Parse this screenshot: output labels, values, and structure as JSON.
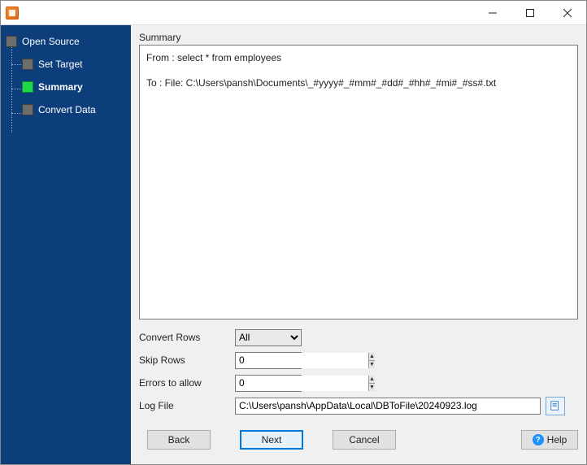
{
  "window": {
    "title": ""
  },
  "sidebar": {
    "items": [
      {
        "label": "Open Source"
      },
      {
        "label": "Set Target"
      },
      {
        "label": "Summary"
      },
      {
        "label": "Convert Data"
      }
    ]
  },
  "summary": {
    "section_label": "Summary",
    "from_line": "From : select * from employees",
    "to_line": "To : File: C:\\Users\\pansh\\Documents\\_#yyyy#_#mm#_#dd#_#hh#_#mi#_#ss#.txt"
  },
  "form": {
    "convert_rows_label": "Convert Rows",
    "convert_rows_value": "All",
    "skip_rows_label": "Skip Rows",
    "skip_rows_value": "0",
    "errors_label": "Errors to allow",
    "errors_value": "0",
    "log_file_label": "Log File",
    "log_file_value": "C:\\Users\\pansh\\AppData\\Local\\DBToFile\\20240923.log"
  },
  "buttons": {
    "back": "Back",
    "next": "Next",
    "cancel": "Cancel",
    "help": "Help"
  }
}
